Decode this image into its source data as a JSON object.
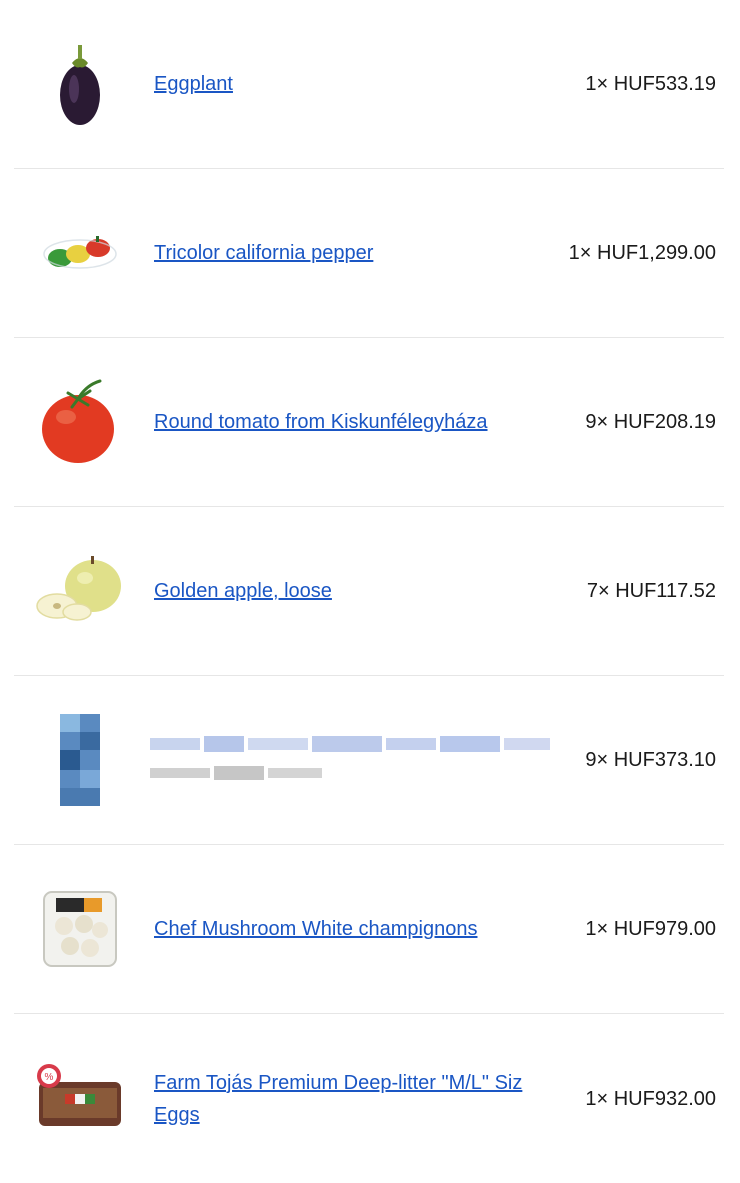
{
  "items": [
    {
      "name": "Eggplant",
      "qty": "1×",
      "price": "HUF533.19",
      "icon": "eggplant-icon"
    },
    {
      "name": "Tricolor california pepper",
      "qty": "1×",
      "price": "HUF1,299.00",
      "icon": "pepper-icon"
    },
    {
      "name": "Round tomato from Kiskunfélegyháza",
      "qty": "9×",
      "price": "HUF208.19",
      "icon": "tomato-icon"
    },
    {
      "name": "Golden apple, loose",
      "qty": "7×",
      "price": "HUF117.52",
      "icon": "apple-icon"
    },
    {
      "name": "",
      "qty": "9×",
      "price": "HUF373.10",
      "icon": "blurred-product-icon"
    },
    {
      "name": "Chef Mushroom White champignons",
      "qty": "1×",
      "price": "HUF979.00",
      "icon": "mushroom-pack-icon"
    },
    {
      "name": "Farm Tojás Premium Deep-litter \"M/L\" Siz Eggs",
      "qty": "1×",
      "price": "HUF932.00",
      "icon": "egg-carton-icon"
    }
  ],
  "colors": {
    "link": "#1a56c4",
    "divider": "#e6e6e6",
    "text": "#1a1a1a"
  }
}
